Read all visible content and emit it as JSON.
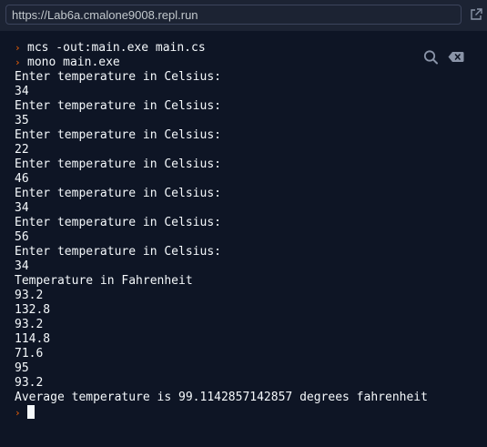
{
  "url_bar": {
    "url": "https://Lab6a.cmalone9008.repl.run",
    "open_icon": "external-link-icon"
  },
  "console": {
    "tools": [
      "search-icon",
      "clear-console-icon"
    ],
    "prompt_symbol": "›",
    "commands": [
      "mcs -out:main.exe main.cs",
      "mono main.exe"
    ],
    "output_lines": [
      "Enter temperature in Celsius:",
      "34",
      "Enter temperature in Celsius:",
      "35",
      "Enter temperature in Celsius:",
      "22",
      "Enter temperature in Celsius:",
      "46",
      "Enter temperature in Celsius:",
      "34",
      "Enter temperature in Celsius:",
      "56",
      "Enter temperature in Celsius:",
      "34",
      "Temperature in Fahrenheit",
      "93.2",
      "132.8",
      "93.2",
      "114.8",
      "71.6",
      "95",
      "93.2",
      "Average temperature is 99.1142857142857 degrees fahrenheit"
    ]
  },
  "colors": {
    "background": "#1c2333",
    "console_background": "#0e1525",
    "text": "#f5f9fc",
    "prompt_accent": "#f26207"
  }
}
